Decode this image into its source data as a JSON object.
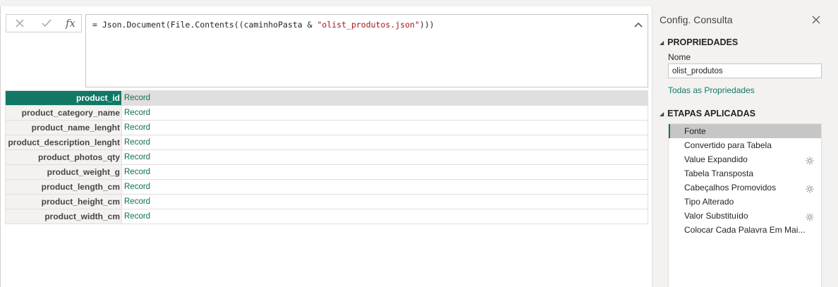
{
  "formula_bar": {
    "prefix": "= Json.Document(File.Contents((caminhoPasta & ",
    "string": "\"olist_produtos.json\"",
    "suffix": ")))",
    "fx_label": "fx"
  },
  "table": {
    "rows": [
      {
        "key": "product_id",
        "value": "Record"
      },
      {
        "key": "product_category_name",
        "value": "Record"
      },
      {
        "key": "product_name_lenght",
        "value": "Record"
      },
      {
        "key": "product_description_lenght",
        "value": "Record"
      },
      {
        "key": "product_photos_qty",
        "value": "Record"
      },
      {
        "key": "product_weight_g",
        "value": "Record"
      },
      {
        "key": "product_length_cm",
        "value": "Record"
      },
      {
        "key": "product_height_cm",
        "value": "Record"
      },
      {
        "key": "product_width_cm",
        "value": "Record"
      }
    ]
  },
  "query_settings": {
    "title": "Config. Consulta",
    "properties_header": "PROPRIEDADES",
    "name_label": "Nome",
    "name_value": "olist_produtos",
    "all_properties_link": "Todas as Propriedades",
    "steps_header": "ETAPAS APLICADAS",
    "steps": [
      {
        "label": "Fonte",
        "has_gear": false
      },
      {
        "label": "Convertido para Tabela",
        "has_gear": false
      },
      {
        "label": "Value Expandido",
        "has_gear": true
      },
      {
        "label": "Tabela Transposta",
        "has_gear": false
      },
      {
        "label": "Cabeçalhos Promovidos",
        "has_gear": true
      },
      {
        "label": "Tipo Alterado",
        "has_gear": false
      },
      {
        "label": "Valor Substituído",
        "has_gear": true
      },
      {
        "label": "Colocar Cada Palavra Em Mai...",
        "has_gear": false
      }
    ]
  },
  "colors": {
    "accent": "#117865",
    "record_text": "#0e6e4f",
    "string_literal": "#a31515"
  }
}
